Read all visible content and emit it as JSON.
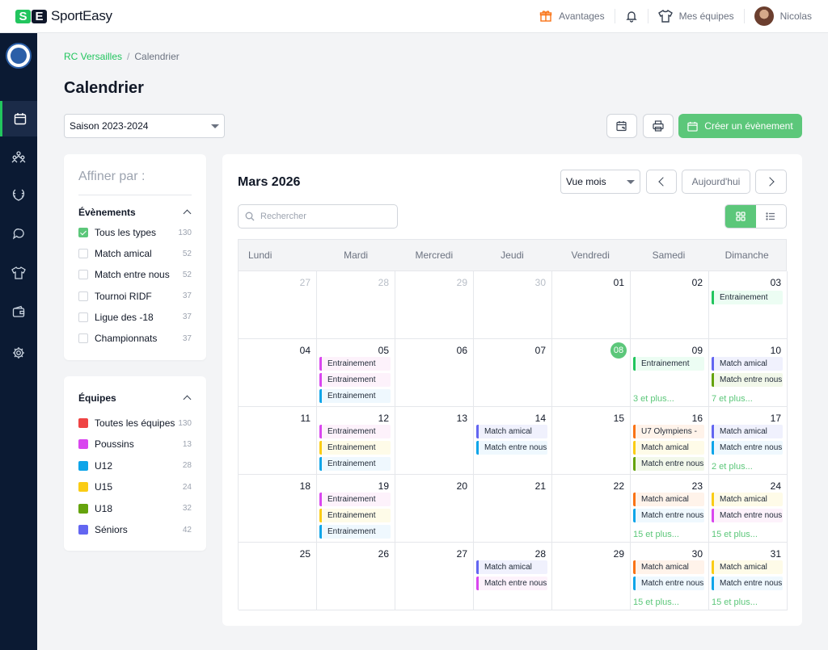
{
  "brand": {
    "mark": [
      "S",
      "E"
    ],
    "name": "SportEasy"
  },
  "topnav": {
    "advantages": "Avantages",
    "my_teams": "Mes équipes",
    "user": "Nicolas"
  },
  "breadcrumb": {
    "club": "RC Versailles",
    "current": "Calendrier"
  },
  "page": {
    "title": "Calendrier"
  },
  "season": {
    "selected": "Saison 2023-2024"
  },
  "actions": {
    "create": "Créer un évènement"
  },
  "filters": {
    "title": "Affiner par :",
    "events": {
      "title": "Évènements",
      "items": [
        {
          "label": "Tous les types",
          "count": "130",
          "checked": true
        },
        {
          "label": "Match amical",
          "count": "52",
          "checked": false
        },
        {
          "label": "Match entre nous",
          "count": "52",
          "checked": false
        },
        {
          "label": "Tournoi RIDF",
          "count": "37",
          "checked": false
        },
        {
          "label": "Ligue des -18",
          "count": "37",
          "checked": false
        },
        {
          "label": "Championnats",
          "count": "37",
          "checked": false
        }
      ]
    },
    "teams": {
      "title": "Équipes",
      "items": [
        {
          "label": "Toutes les équipes",
          "count": "130",
          "color": "#ef4444"
        },
        {
          "label": "Poussins",
          "count": "13",
          "color": "#d946ef"
        },
        {
          "label": "U12",
          "count": "28",
          "color": "#0ea5e9"
        },
        {
          "label": "U15",
          "count": "24",
          "color": "#facc15"
        },
        {
          "label": "U18",
          "count": "32",
          "color": "#65a30d"
        },
        {
          "label": "Séniors",
          "count": "42",
          "color": "#6366f1"
        }
      ]
    }
  },
  "calendar": {
    "month": "Mars 2026",
    "view": "Vue mois",
    "today_label": "Aujourd'hui",
    "search_placeholder": "Rechercher",
    "weekdays": [
      "Lundi",
      "Mardi",
      "Mercredi",
      "Jeudi",
      "Vendredi",
      "Samedi",
      "Dimanche"
    ],
    "colors": {
      "green": "#22c55e",
      "pink": "#d946ef",
      "blue": "#0ea5e9",
      "yellow": "#facc15",
      "purple": "#6366f1",
      "olive": "#65a30d",
      "orange": "#f97316"
    },
    "tints": {
      "green": "#ecfdf3",
      "pink": "#fdf2fb",
      "blue": "#eff8fe",
      "yellow": "#fefbe8",
      "purple": "#f0f1fd",
      "olive": "#f2f8ea",
      "orange": "#fff3ea"
    },
    "weeks": [
      [
        {
          "day": "27",
          "muted": true,
          "events": []
        },
        {
          "day": "28",
          "muted": true,
          "events": []
        },
        {
          "day": "29",
          "muted": true,
          "events": []
        },
        {
          "day": "30",
          "muted": true,
          "events": []
        },
        {
          "day": "01",
          "events": []
        },
        {
          "day": "02",
          "events": []
        },
        {
          "day": "03",
          "events": [
            {
              "label": "Entrainement",
              "color": "green"
            }
          ]
        }
      ],
      [
        {
          "day": "04",
          "events": []
        },
        {
          "day": "05",
          "events": [
            {
              "label": "Entrainement",
              "color": "pink"
            },
            {
              "label": "Entrainement",
              "color": "pink"
            },
            {
              "label": "Entrainement",
              "color": "blue"
            }
          ]
        },
        {
          "day": "06",
          "events": []
        },
        {
          "day": "07",
          "events": []
        },
        {
          "day": "08",
          "today": true,
          "events": []
        },
        {
          "day": "09",
          "events": [
            {
              "label": "Entrainement",
              "color": "green"
            }
          ],
          "more": "3 et plus..."
        },
        {
          "day": "10",
          "events": [
            {
              "label": "Match amical",
              "color": "purple"
            },
            {
              "label": "Match entre nous",
              "color": "olive"
            }
          ],
          "more": "7 et plus..."
        }
      ],
      [
        {
          "day": "11",
          "events": []
        },
        {
          "day": "12",
          "events": [
            {
              "label": "Entrainement",
              "color": "pink"
            },
            {
              "label": "Entrainement",
              "color": "yellow"
            },
            {
              "label": "Entrainement",
              "color": "blue"
            }
          ]
        },
        {
          "day": "13",
          "events": []
        },
        {
          "day": "14",
          "events": [
            {
              "label": "Match amical",
              "color": "purple"
            },
            {
              "label": "Match entre nous",
              "color": "blue"
            }
          ]
        },
        {
          "day": "15",
          "events": []
        },
        {
          "day": "16",
          "events": [
            {
              "label": "U7 Olympiens - ",
              "color": "orange"
            },
            {
              "label": "Match amical",
              "color": "yellow"
            },
            {
              "label": "Match entre nous",
              "color": "olive"
            }
          ]
        },
        {
          "day": "17",
          "events": [
            {
              "label": "Match amical",
              "color": "purple"
            },
            {
              "label": "Match entre nous",
              "color": "blue"
            }
          ],
          "more": "2 et plus..."
        }
      ],
      [
        {
          "day": "18",
          "events": []
        },
        {
          "day": "19",
          "events": [
            {
              "label": "Entrainement",
              "color": "pink"
            },
            {
              "label": "Entrainement",
              "color": "yellow"
            },
            {
              "label": "Entrainement",
              "color": "blue"
            }
          ]
        },
        {
          "day": "20",
          "events": []
        },
        {
          "day": "21",
          "events": []
        },
        {
          "day": "22",
          "events": []
        },
        {
          "day": "23",
          "events": [
            {
              "label": "Match amical",
              "color": "orange"
            },
            {
              "label": "Match entre nous",
              "color": "blue"
            }
          ],
          "more": "15 et plus..."
        },
        {
          "day": "24",
          "events": [
            {
              "label": "Match amical",
              "color": "yellow"
            },
            {
              "label": "Match entre nous",
              "color": "pink"
            }
          ],
          "more": "15 et plus..."
        }
      ],
      [
        {
          "day": "25",
          "events": []
        },
        {
          "day": "26",
          "events": []
        },
        {
          "day": "27",
          "events": []
        },
        {
          "day": "28",
          "events": [
            {
              "label": "Match amical",
              "color": "purple"
            },
            {
              "label": "Match entre nous",
              "color": "pink"
            }
          ]
        },
        {
          "day": "29",
          "events": []
        },
        {
          "day": "30",
          "events": [
            {
              "label": "Match amical",
              "color": "orange"
            },
            {
              "label": "Match entre nous",
              "color": "blue"
            }
          ],
          "more": "15 et plus..."
        },
        {
          "day": "31",
          "events": [
            {
              "label": "Match amical",
              "color": "yellow"
            },
            {
              "label": "Match entre nous",
              "color": "blue"
            }
          ],
          "more": "15 et plus..."
        }
      ]
    ]
  }
}
